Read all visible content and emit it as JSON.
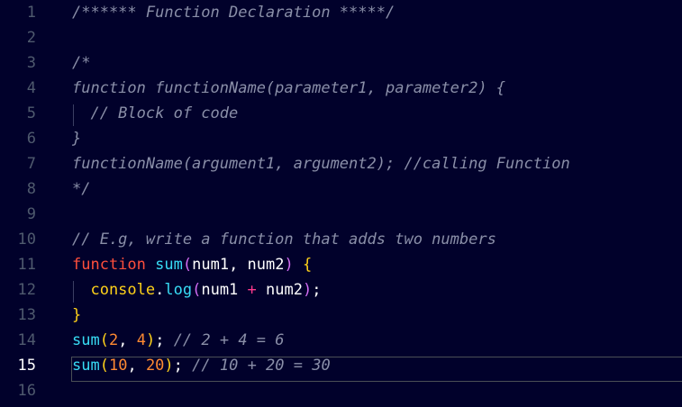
{
  "editor": {
    "active_line": "15",
    "lines": [
      {
        "n": "1",
        "tokens": [
          {
            "t": "/****** Function Declaration *****/",
            "c": "comment"
          }
        ]
      },
      {
        "n": "2",
        "tokens": []
      },
      {
        "n": "3",
        "tokens": [
          {
            "t": "/*",
            "c": "comment"
          }
        ]
      },
      {
        "n": "4",
        "tokens": [
          {
            "t": "function functionName(parameter1, parameter2) {",
            "c": "comment"
          }
        ]
      },
      {
        "n": "5",
        "tokens": [
          {
            "t": "  // Block of code",
            "c": "comment"
          }
        ]
      },
      {
        "n": "6",
        "tokens": [
          {
            "t": "}",
            "c": "comment"
          }
        ]
      },
      {
        "n": "7",
        "tokens": [
          {
            "t": "functionName(argument1, argument2); //calling Function",
            "c": "comment"
          }
        ]
      },
      {
        "n": "8",
        "tokens": [
          {
            "t": "*/",
            "c": "comment"
          }
        ]
      },
      {
        "n": "9",
        "tokens": []
      },
      {
        "n": "10",
        "tokens": [
          {
            "t": "// E.g, write a function that adds two numbers",
            "c": "comment"
          }
        ]
      },
      {
        "n": "11",
        "tokens": [
          {
            "t": "function",
            "c": "kw"
          },
          {
            "t": " ",
            "c": "plain"
          },
          {
            "t": "sum",
            "c": "fn"
          },
          {
            "t": "(",
            "c": "pr"
          },
          {
            "t": "num1",
            "c": "plain"
          },
          {
            "t": ", ",
            "c": "plain"
          },
          {
            "t": "num2",
            "c": "plain"
          },
          {
            "t": ")",
            "c": "pr"
          },
          {
            "t": " ",
            "c": "plain"
          },
          {
            "t": "{",
            "c": "br"
          }
        ]
      },
      {
        "n": "12",
        "tokens": [
          {
            "t": "  console",
            "c": "br"
          },
          {
            "t": ".",
            "c": "plain"
          },
          {
            "t": "log",
            "c": "fn"
          },
          {
            "t": "(",
            "c": "pr"
          },
          {
            "t": "num1",
            "c": "plain"
          },
          {
            "t": " + ",
            "c": "op"
          },
          {
            "t": "num2",
            "c": "plain"
          },
          {
            "t": ")",
            "c": "pr"
          },
          {
            "t": ";",
            "c": "plain"
          }
        ]
      },
      {
        "n": "13",
        "tokens": [
          {
            "t": "}",
            "c": "br"
          }
        ]
      },
      {
        "n": "14",
        "tokens": [
          {
            "t": "sum",
            "c": "fn"
          },
          {
            "t": "(",
            "c": "br"
          },
          {
            "t": "2",
            "c": "num"
          },
          {
            "t": ", ",
            "c": "plain"
          },
          {
            "t": "4",
            "c": "num"
          },
          {
            "t": ")",
            "c": "br"
          },
          {
            "t": "; ",
            "c": "plain"
          },
          {
            "t": "// 2 + 4 = 6",
            "c": "comment"
          }
        ]
      },
      {
        "n": "15",
        "tokens": [
          {
            "t": "sum",
            "c": "fn"
          },
          {
            "t": "(",
            "c": "br"
          },
          {
            "t": "10",
            "c": "num"
          },
          {
            "t": ", ",
            "c": "plain"
          },
          {
            "t": "20",
            "c": "num"
          },
          {
            "t": ")",
            "c": "br"
          },
          {
            "t": "; ",
            "c": "plain"
          },
          {
            "t": "// 10 + 20 = 30",
            "c": "comment"
          }
        ]
      },
      {
        "n": "16",
        "tokens": []
      }
    ]
  },
  "colors": {
    "background": "#01012b",
    "comment": "#8a8fa8",
    "keyword": "#ff4f3c",
    "function": "#38dcf5",
    "brace": "#ffd21a",
    "paren": "#d36cf3",
    "number": "#ff8a32",
    "operator": "#ff3a8c"
  }
}
